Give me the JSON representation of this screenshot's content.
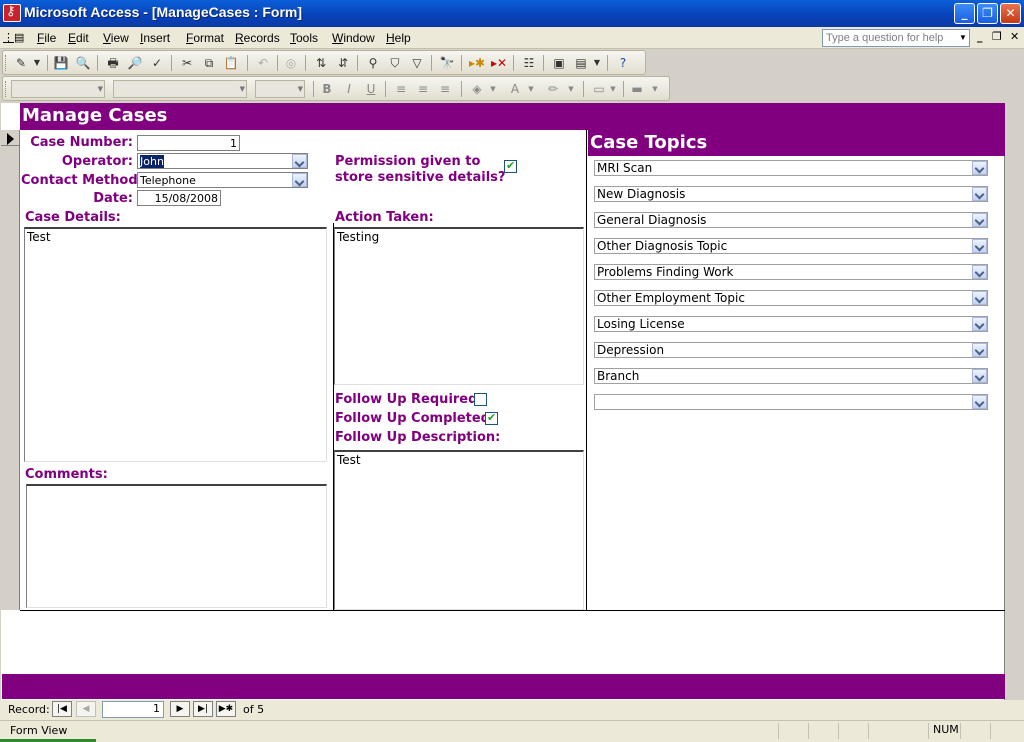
{
  "window": {
    "title": "Microsoft Access - [ManageCases : Form]"
  },
  "menu": {
    "items": [
      "File",
      "Edit",
      "View",
      "Insert",
      "Format",
      "Records",
      "Tools",
      "Window",
      "Help"
    ],
    "help_placeholder": "Type a question for help"
  },
  "form": {
    "title": "Manage Cases",
    "case_number_label": "Case Number:",
    "case_number": "1",
    "operator_label": "Operator:",
    "operator": "John",
    "contact_method_label": "Contact Method:",
    "contact_method": "Telephone",
    "date_label": "Date:",
    "date": "15/08/2008",
    "permission_label_1": "Permission given to",
    "permission_label_2": "store sensitive details?",
    "permission_checked": true,
    "case_details_label": "Case Details:",
    "case_details": "Test",
    "action_taken_label": "Action Taken:",
    "action_taken": "Testing",
    "follow_up_required_label": "Follow Up Required?",
    "follow_up_required": false,
    "follow_up_completed_label": "Follow Up Completed?",
    "follow_up_completed": true,
    "follow_up_description_label": "Follow Up Description:",
    "follow_up_description": "Test",
    "comments_label": "Comments:",
    "comments": ""
  },
  "topics": {
    "header": "Case Topics",
    "items": [
      "MRI Scan",
      "New Diagnosis",
      "General Diagnosis",
      "Other Diagnosis Topic",
      "Problems Finding Work",
      "Other Employment Topic",
      "Losing License",
      "Depression",
      "Branch",
      ""
    ]
  },
  "navigation": {
    "label": "Record:",
    "current": "1",
    "of_text": "of  5"
  },
  "status": {
    "view": "Form View",
    "num": "NUM"
  },
  "colors": {
    "accent": "#800080",
    "titlebar": "#0a5fd8"
  }
}
